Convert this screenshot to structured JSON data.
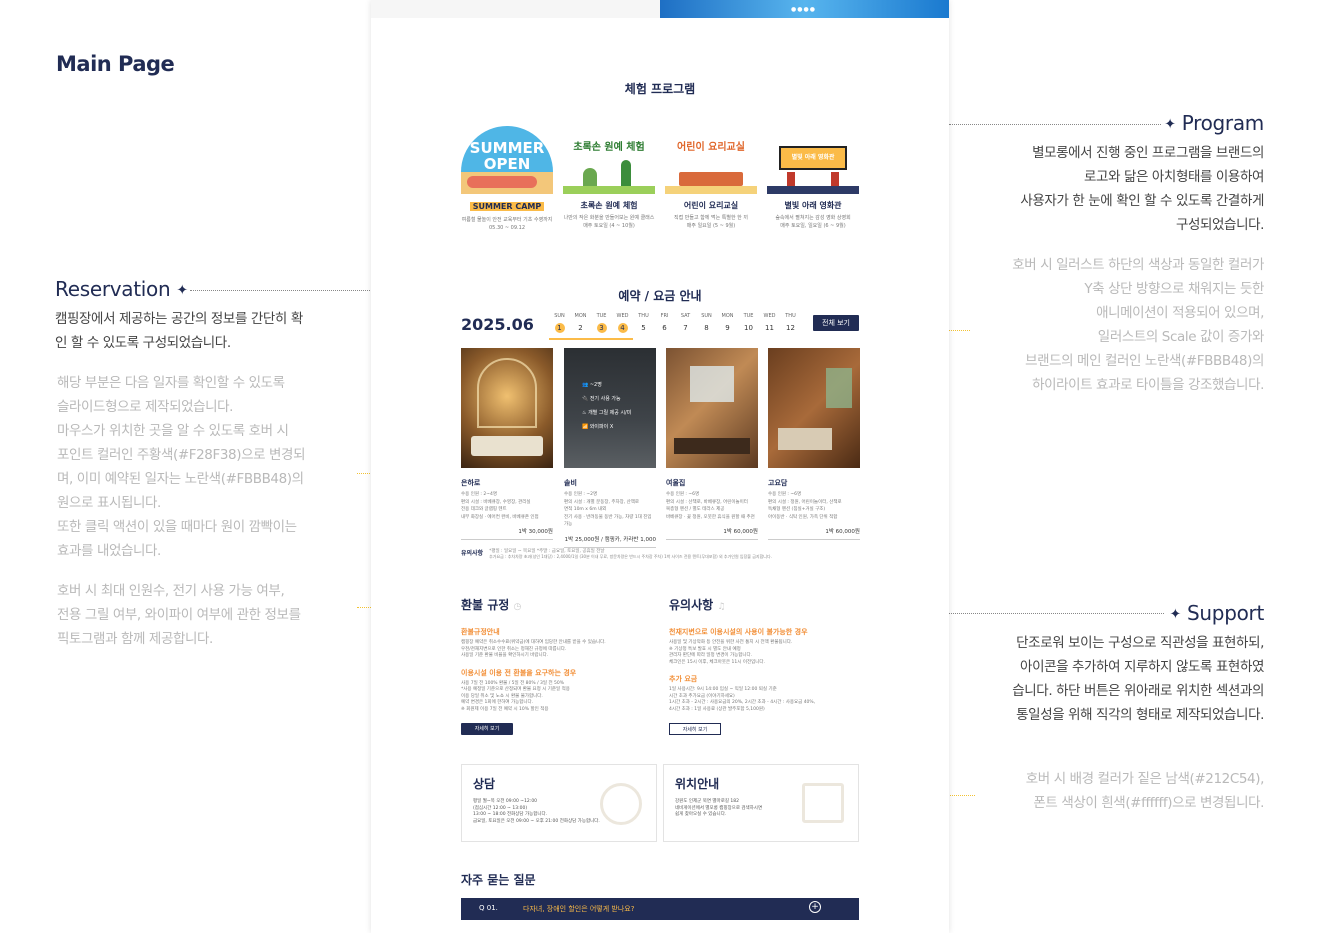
{
  "main_title": "Main Page",
  "reservation": {
    "title": "Reservation",
    "body": [
      "캠핑장에서 제공하는 공간의 정보를 간단히 확",
      "인 할 수 있도록 구성되었습니다."
    ],
    "note1": [
      "해당 부분은 다음 일자를 확인할 수 있도록",
      "슬라이드형으로 제작되었습니다.",
      "마우스가 위치한 곳을 알 수 있도록 호버 시",
      "포인트 컬러인 주황색(#F28F38)으로 변경되",
      "며, 이미 예약된 일자는 노란색(#FBBB48)의",
      "원으로 표시됩니다.",
      "또한 클릭 액션이 있을 때마다 원이 깜빡이는",
      "효과를 내었습니다."
    ],
    "note2": [
      "호버 시 최대 인원수, 전기 사용 가능 여부,",
      "전용 그릴 여부, 와이파이 여부에 관한 정보를",
      "픽토그램과 함께  제공합니다."
    ]
  },
  "program": {
    "title": "Program",
    "body": [
      "별모롱에서 진행 중인 프로그램을 브랜드의",
      "로고와 닮은 아치형태를 이용하여",
      "사용자가 한 눈에 확인 할 수 있도록 간결하게",
      "구성되었습니다."
    ],
    "note": [
      "호버 시 일러스트 하단의 색상과 동일한 컬러가",
      "Y축 상단 방향으로 채워지는 듯한",
      "애니메이션이 적용되어 있으며,",
      "일러스트의 Scale 값이 증가와",
      "브랜드의 메인 컬러인 노란색(#FBBB48)의",
      "하이라이트 효과로 타이틀을 강조했습니다."
    ]
  },
  "support": {
    "title": "Support",
    "body": [
      "단조로워 보이는 구성으로 직관성을 표현하되,",
      "아이콘을 추가하여 지루하지 않도록 표현하였",
      "습니다. 하단 버튼은 위아래로 위치한 섹션과의",
      "통일성을 위해 직각의 형태로 제작되었습니다."
    ],
    "note": [
      "호버 시 배경 컬러가 짙은 남색(#212C54),",
      "폰트 색상이 흰색(#ffffff)으로 변경됩니다."
    ]
  },
  "site": {
    "hero_dots": "●●●●",
    "program_section_title": "체험 프로그램",
    "programs": [
      {
        "art": "SUMMER OPEN",
        "name": "SUMMER CAMP",
        "desc": [
          "여름철 물놀이 안전 교육부터 기초 수영까지",
          "05.30 ~ 09.12"
        ]
      },
      {
        "art": "초록손 원예 체험",
        "name": "초록손 원예 체험",
        "desc": [
          "나만의 작은 화분을 만들어보는 원예 클래스",
          "매주 토요일 (4 ~ 10월)"
        ]
      },
      {
        "art": "어린이 요리교실",
        "name": "어린이 요리교실",
        "desc": [
          "직접 만들고 함께 먹는 특별한 한 끼",
          "매주 일요일 (5 ~ 9월)"
        ]
      },
      {
        "art": "별빛 아래 영화관",
        "name": "별빛 아래 영화관",
        "desc": [
          "숲속에서 펼쳐지는 감성 영화 상영회",
          "매주 토요일, 일요일 (6 ~ 9월)"
        ]
      }
    ],
    "reservation_section_title": "예약 / 요금 안내",
    "year_month": "2025.06",
    "calendar": {
      "days": [
        "SUN",
        "MON",
        "TUE",
        "WED",
        "THU",
        "FRI",
        "SAT",
        "SUN",
        "MON",
        "TUE",
        "WED",
        "THU"
      ],
      "dates": [
        "1",
        "2",
        "3",
        "4",
        "5",
        "6",
        "7",
        "8",
        "9",
        "10",
        "11",
        "12"
      ],
      "reserved": [
        1,
        3,
        4
      ]
    },
    "view_all_label": "전체 보기",
    "rooms": [
      {
        "name": "은하로",
        "info": [
          "수용 인원 : 2~4명",
          "편의 시설 : 바베큐장, 수영장, 관리실",
          "전용 데크와 글램핑 텐트",
          "내부 화장실 · 에어컨 완비, 바베큐존 인접"
        ],
        "price": "1박 30,000원"
      },
      {
        "name": "솔비",
        "info": [
          "수용 인원 : ~2명",
          "편의 시설 : 개별 분동장, 주차장, 산책로",
          "면적 10m x 6m 내외",
          "전기 사용 · 반려동물 동반 가능, 차량 1대 진입 가능"
        ],
        "price": "1박 25,000원 / 캠핑카, 카라반 1,000"
      },
      {
        "name": "여울집",
        "info": [
          "수용 인원 : ~6명",
          "편의 시설 : 산책로, 바베큐장, 어린이놀이터",
          "복층형 펜션 / 별도 테라스 제공",
          "바베큐장 · 꽃 정원, 오붓한 휴식을 원할 때 추천"
        ],
        "price": "1박 60,000원"
      },
      {
        "name": "고요담",
        "info": [
          "수용 인원 : ~6명",
          "편의 시설 : 정원, 어린이놀이터, 산책로",
          "독채형 펜션 (침실+거실 구조)",
          "아이동반 · 식탁 인원, 가족 단위 적합"
        ],
        "price": "1박 60,000원"
      }
    ],
    "hover_icons": {
      "labels": [
        "~2명",
        "전기 사용 가능",
        "개별 그릴 제공 시/미",
        "와이파이 X"
      ]
    },
    "notice_label": "유의사항",
    "notice_lines": [
      "*평일 : 일요일 ~ 목요일 *주말 : 금요일, 토요일, 공휴일 전날",
      "추가요금 : 추차차량 초과(성인 1대당) : 2,4000/1일 (30분 이내 무료, 방문차량은 반드시 주차장 주차) 1박 사이즈 전용 텐트(무대포함) 외 추가인원 입장불 금지합니다."
    ],
    "refund": {
      "title": "환불 규정",
      "h1": "환불규정안내",
      "p1": [
        "캠핑장 예약은 취소수수료(위약금)에 대하여 임당한 안내를 받을 수 있습니다.",
        "우천/천재지변으로 인한 취소는 정해진 규정에 따릅니다.",
        "사용일 기준 환불 비율을 확인하시기 바랍니다."
      ],
      "h2": "이용시설 이용 전 환불을 요구하는 경우",
      "p2": [
        "사용 7일 전 100% 환불 / 5일 전 80% / 3일 전 50%",
        "*사용 예정일 기준으로 산정되며 환불 요청 시 기준일 적용",
        "이용 당일 취소 및 노쇼 시 환불 불가합니다.",
        "예약 변경은 1회에 한하여 가능합니다.",
        "※ 회원제 이용 7일 전 예약 시 10% 할인 적용"
      ],
      "button": "자세히 보기"
    },
    "caution": {
      "title": "유의사항",
      "h1": "천재지변으로 이용시설의 사용이 불가능한 경우",
      "p1": [
        "사용일 및 기상악화 등 안전을 위한 사전 통지 시 전액 환불됩니다.",
        "※ 기상청 특보 발효 시 별도 안내 예정",
        "관리자 판단에 따라 일정 변경이 가능합니다.",
        "체크인은 15시 이후, 체크아웃은 11시 이전입니다."
      ],
      "h2": "추가 요금",
      "p2": [
        "1일 사용시간: 9시 14:00 입실 ~ 익일 12:00 퇴실 기준",
        "시간 초과 추가요금 (이야기하세요)",
        "1시간 초과 - 2시간 : 사용요금의 20%, 2시간 초과 - 4시간 : 사용요금 40%,",
        "4시간 초과 : 1일 사용료 (상관 발주포함 5,100원)"
      ],
      "button": "자세히 보기"
    },
    "consult": {
      "title": "상담",
      "lines": [
        "평일 월~목 오전 09:00 ~12:00",
        "(점심시간 12:00 ~ 13:00)",
        "13:00 ~ 18:00 전화상담 가능합니다.",
        "금요일, 토요일은 오전 09:00 ~ 오후 21:00 전화상담 가능합니다."
      ]
    },
    "location": {
      "title": "위치안내",
      "lines": [
        "강원도 인제군 북면 별마로길 182",
        "네비게이션에서 별모롱 캠핑장으로 검색하시면",
        "쉽게 찾아오실 수 있습니다."
      ]
    },
    "faq": {
      "title": "자주 묻는 질문",
      "q_no": "Q 01.",
      "q_text": "다자녀, 장애인 할인은 어떻게 받나요?"
    }
  },
  "colors": {
    "navy": "#212C54",
    "yellow": "#FBBB48",
    "orange": "#F28F38"
  }
}
